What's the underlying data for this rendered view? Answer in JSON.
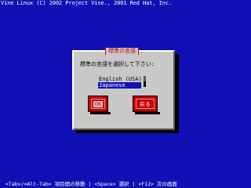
{
  "header": {
    "text": "Vine Linux (C) 2002 Project Vine., 2001 Red Hat, Inc."
  },
  "dialog": {
    "title": "標準の言語",
    "prompt": "標準の言語を選択して下さい:",
    "languages": [
      {
        "label": "English (USA)",
        "selected": false
      },
      {
        "label": "Japanese",
        "selected": true
      }
    ],
    "buttons": {
      "ok": "OK",
      "back": "戻る"
    }
  },
  "footer": {
    "text": "<Tab>/<Alt-Tab> 項目間の移動 | <Space> 選択 | <F12> 次の画面"
  },
  "colors": {
    "background": "#1010b4",
    "dialog": "#c8c8c8",
    "button": "#c40000",
    "selection": "#1010b4"
  }
}
